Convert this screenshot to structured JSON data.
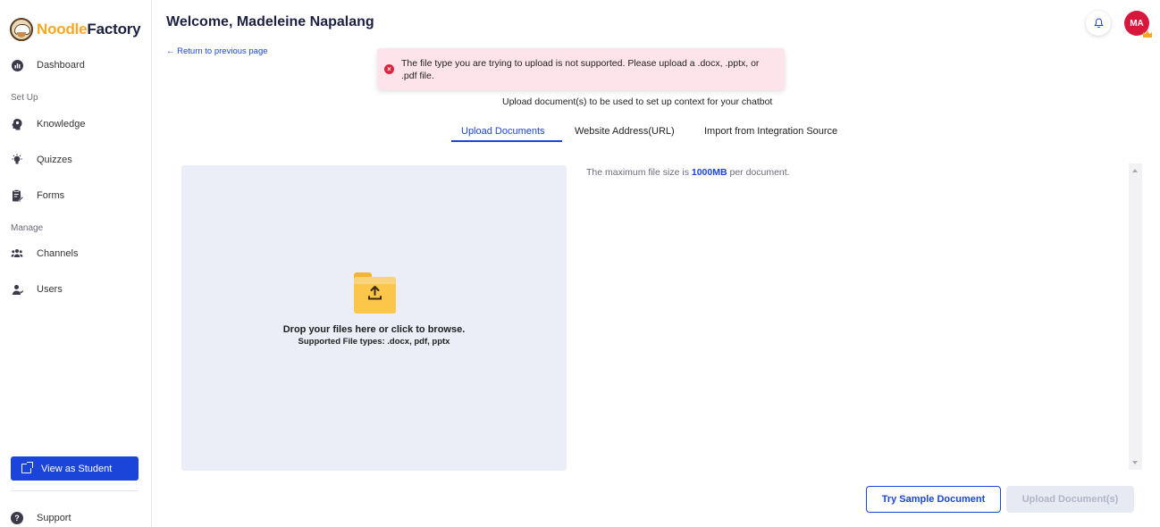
{
  "brand": {
    "part1": "Noodle",
    "part2": "Factory",
    "accent": "#f6a823",
    "dark": "#1c2142"
  },
  "sidebar": {
    "items": [
      {
        "label": "Dashboard",
        "icon": "dashboard-icon"
      },
      {
        "label": "Knowledge",
        "icon": "knowledge-icon"
      },
      {
        "label": "Quizzes",
        "icon": "lightbulb-icon"
      },
      {
        "label": "Forms",
        "icon": "forms-icon"
      },
      {
        "label": "Channels",
        "icon": "people-icon"
      },
      {
        "label": "Users",
        "icon": "user-icon"
      }
    ],
    "sections": {
      "setup": "Set Up",
      "manage": "Manage"
    },
    "view_as_student": "View as Student",
    "support": "Support"
  },
  "header": {
    "welcome": "Welcome, Madeleine Napalang",
    "return_link": "← Return to previous page",
    "avatar_initials": "MA"
  },
  "toast": {
    "message": "The file type you are trying to upload is not supported. Please upload a .docx, .pptx, or .pdf file.",
    "color": "#fde4ea"
  },
  "main": {
    "subtitle": "Upload document(s) to be used to set up context for your chatbot",
    "tabs": [
      {
        "label": "Upload Documents",
        "active": true
      },
      {
        "label": "Website Address(URL)",
        "active": false
      },
      {
        "label": "Import from Integration Source",
        "active": false
      }
    ],
    "dropzone": {
      "title": "Drop your files here or click to browse.",
      "subtitle": "Supported File types: .docx, pdf, pptx"
    },
    "max_size": {
      "prefix": "The maximum file size is ",
      "value": "1000MB",
      "suffix": " per document."
    },
    "buttons": {
      "sample": "Try Sample Document",
      "upload": "Upload Document(s)"
    }
  },
  "colors": {
    "primary": "#1b45d8",
    "error": "#e0233f",
    "avatar": "#d7173c"
  }
}
